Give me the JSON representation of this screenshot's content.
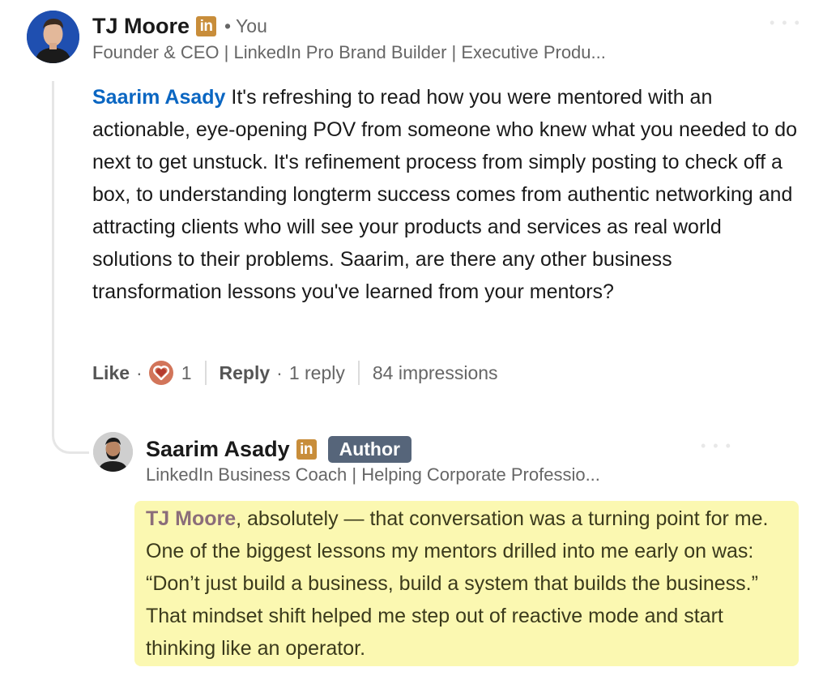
{
  "comment": {
    "author": "TJ Moore",
    "badge": "in",
    "degree": "• You",
    "headline": "Founder & CEO | LinkedIn Pro Brand Builder | Executive Produ...",
    "mention": "Saarim Asady",
    "text": " It's refreshing to read how you were mentored with an actionable, eye-opening POV from someone who knew what you needed to do next to get unstuck. It's refinement process from simply posting to check off a box, to understanding longterm success comes from authentic networking and attracting clients who will see your products and services as real world solutions to their problems. Saarim, are there any other business transformation lessons you've learned from your mentors?",
    "actions": {
      "like": "Like",
      "reaction_count": "1",
      "reply": "Reply",
      "reply_count": "1 reply",
      "impressions": "84 impressions"
    }
  },
  "reply": {
    "author": "Saarim Asady",
    "badge": "in",
    "tag": "Author",
    "headline": "LinkedIn Business Coach | Helping Corporate Professio...",
    "mention": "TJ Moore",
    "text": ", absolutely — that conversation was a turning point for me. One of the biggest lessons my mentors drilled into me early on was: “Don’t just build a business, build a system that builds the business.” That mindset shift helped me step out of reactive mode and start thinking like an operator."
  },
  "colors": {
    "mention_blue": "#0a66c2",
    "linkedin_badge": "#c88d3a",
    "author_tag": "#56657a",
    "highlight": "#fbf8b1",
    "heart_reaction": "#d2755a"
  }
}
